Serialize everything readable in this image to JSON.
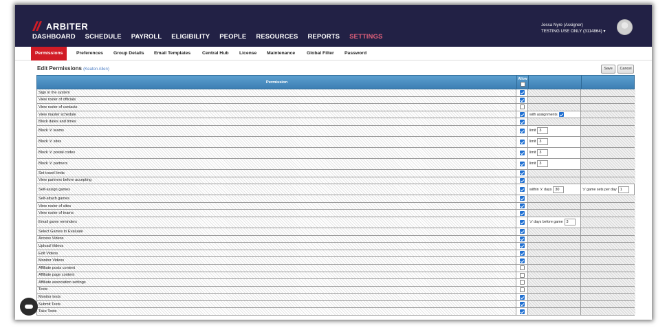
{
  "brand": {
    "logo_text": "ARBITER",
    "accent": "#d11c26",
    "nav_bg": "#222145"
  },
  "main_nav": [
    {
      "label": "DASHBOARD"
    },
    {
      "label": "SCHEDULE"
    },
    {
      "label": "PAYROLL"
    },
    {
      "label": "ELIGIBILITY"
    },
    {
      "label": "PEOPLE"
    },
    {
      "label": "RESOURCES"
    },
    {
      "label": "REPORTS"
    },
    {
      "label": "SETTINGS",
      "active": true
    }
  ],
  "user": {
    "name": "Jessa Nyre (Assigner)",
    "org": "TESTING USE ONLY (3114864) ▾"
  },
  "sub_nav": [
    {
      "label": "Permissions",
      "active": true
    },
    {
      "label": "Preferences"
    },
    {
      "label": "Group Details"
    },
    {
      "label": "Email Templates"
    },
    {
      "label": "Central Hub"
    },
    {
      "label": "License"
    },
    {
      "label": "Maintenance"
    },
    {
      "label": "Global Filter"
    },
    {
      "label": "Password"
    }
  ],
  "page": {
    "title": "Edit Permissions",
    "subject": "(Keaton Allen)"
  },
  "actions": {
    "save": "Save",
    "cancel": "Cancel"
  },
  "table": {
    "header_permission": "Permission",
    "header_allow": "Allow",
    "rows": [
      {
        "label": "Sign in the system",
        "allow": true
      },
      {
        "label": "View roster of officials",
        "allow": true
      },
      {
        "label": "View roster of contacts",
        "allow": false
      },
      {
        "label": "View master schedule",
        "allow": true,
        "opt1_text": "with assignments",
        "opt1_checkbox": true
      },
      {
        "label": "Block dates and times",
        "allow": true
      },
      {
        "label": "Block 'x' teams",
        "allow": true,
        "opt1_text": "limit",
        "opt1_value": "3",
        "tall": true
      },
      {
        "label": "Block 'x' sites",
        "allow": true,
        "opt1_text": "limit",
        "opt1_value": "3",
        "tall": true
      },
      {
        "label": "Block 'x' postal codes",
        "allow": true,
        "opt1_text": "limit",
        "opt1_value": "3",
        "tall": true
      },
      {
        "label": "Block 'x' partners",
        "allow": true,
        "opt1_text": "limit",
        "opt1_value": "3",
        "tall": true
      },
      {
        "label": "Set travel limits",
        "allow": true
      },
      {
        "label": "View partners before accepting",
        "allow": true
      },
      {
        "label": "Self-assign games",
        "allow": true,
        "opt1_text": "within 'x' days",
        "opt1_value": "30",
        "opt2_text": "'x' game sets per day",
        "opt2_value": "1",
        "tall": true
      },
      {
        "label": "Self-attach games",
        "allow": true
      },
      {
        "label": "View roster of sites",
        "allow": true
      },
      {
        "label": "View roster of teams",
        "allow": true
      },
      {
        "label": "Email game reminders",
        "allow": true,
        "opt1_text": "'x' days before game",
        "opt1_value": "3",
        "tall": true
      },
      {
        "label": "Select Games to Evaluate",
        "allow": true
      },
      {
        "label": "Access Videos",
        "allow": true
      },
      {
        "label": "Upload Videos",
        "allow": true
      },
      {
        "label": "Edit Videos",
        "allow": true
      },
      {
        "label": "Monitor Videos",
        "allow": true
      },
      {
        "label": "Affiliate posts content",
        "allow": false
      },
      {
        "label": "Affiliate page content",
        "allow": false
      },
      {
        "label": "Affiliate association settings",
        "allow": false
      },
      {
        "label": "Tests",
        "allow": false
      },
      {
        "label": "Monitor tests",
        "allow": true
      },
      {
        "label": "Submit Tests",
        "allow": true
      },
      {
        "label": "Take Tests",
        "allow": true
      }
    ]
  }
}
